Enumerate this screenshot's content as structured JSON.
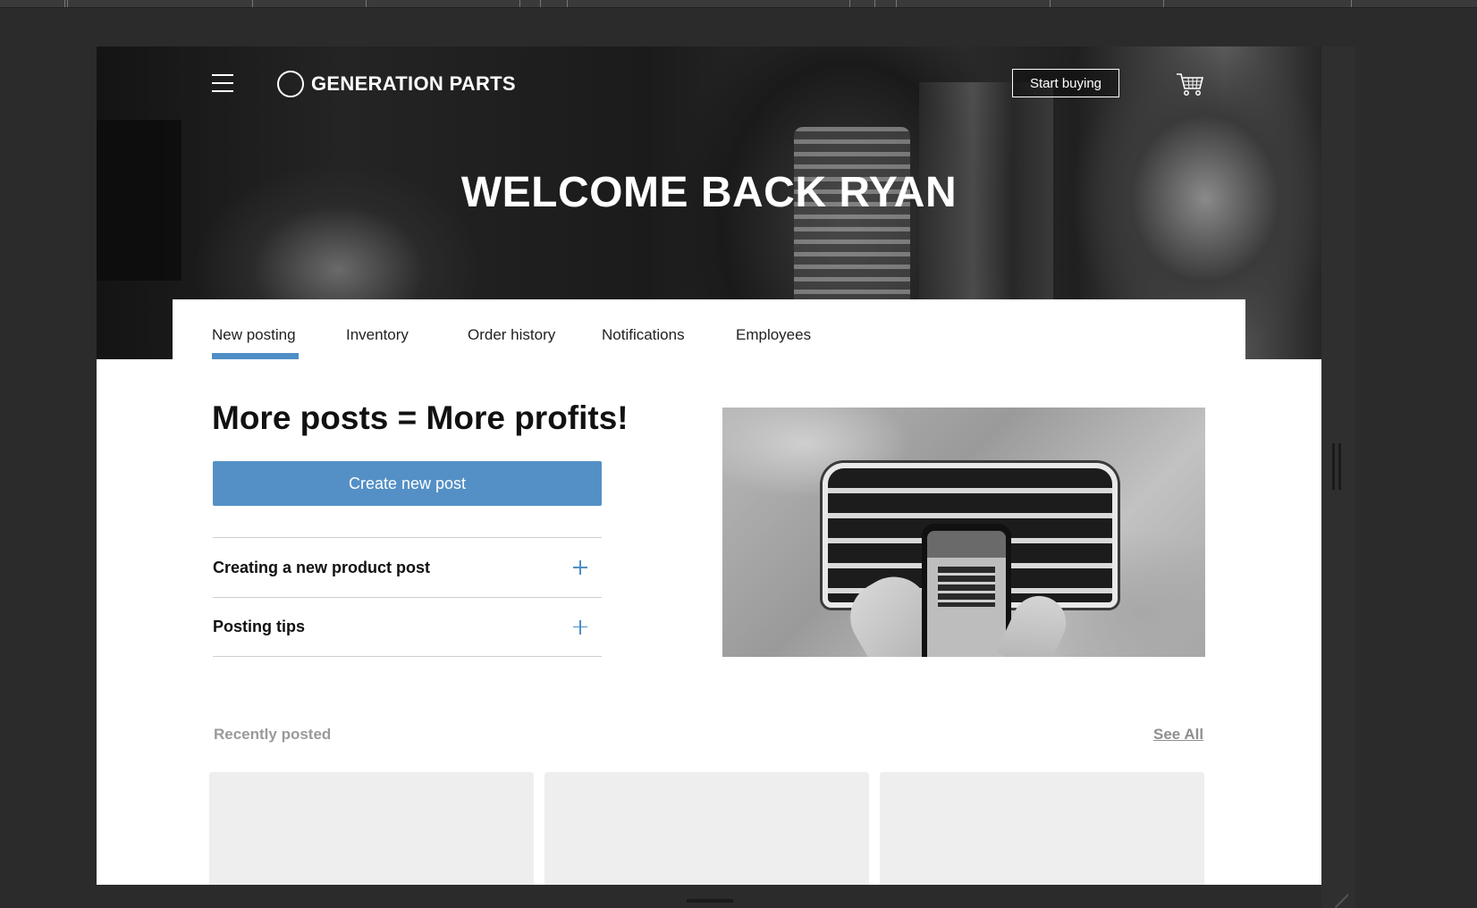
{
  "header": {
    "brand": "GENERATION PARTS",
    "start_buying_label": "Start buying",
    "menu_icon": "hamburger-menu-icon",
    "logo_icon": "circle-logo-icon",
    "cart_icon": "shopping-cart-icon"
  },
  "hero": {
    "title": "WELCOME BACK RYAN"
  },
  "tabs": {
    "items": [
      {
        "label": "New posting",
        "active": true
      },
      {
        "label": "Inventory",
        "active": false
      },
      {
        "label": "Order history",
        "active": false
      },
      {
        "label": "Notifications",
        "active": false
      },
      {
        "label": "Employees",
        "active": false
      }
    ]
  },
  "main": {
    "headline": "More posts = More profits!",
    "create_button_label": "Create new post",
    "accordion": [
      {
        "label": "Creating a new product post",
        "icon": "plus-icon"
      },
      {
        "label": "Posting tips",
        "icon": "plus-icon"
      }
    ]
  },
  "recent": {
    "label": "Recently posted",
    "see_all_label": "See All",
    "card_count": 3
  },
  "colors": {
    "accent": "#5490c6",
    "page_background": "#ffffff",
    "canvas_background": "#2b2b2b",
    "card_placeholder": "#eeeeee"
  }
}
